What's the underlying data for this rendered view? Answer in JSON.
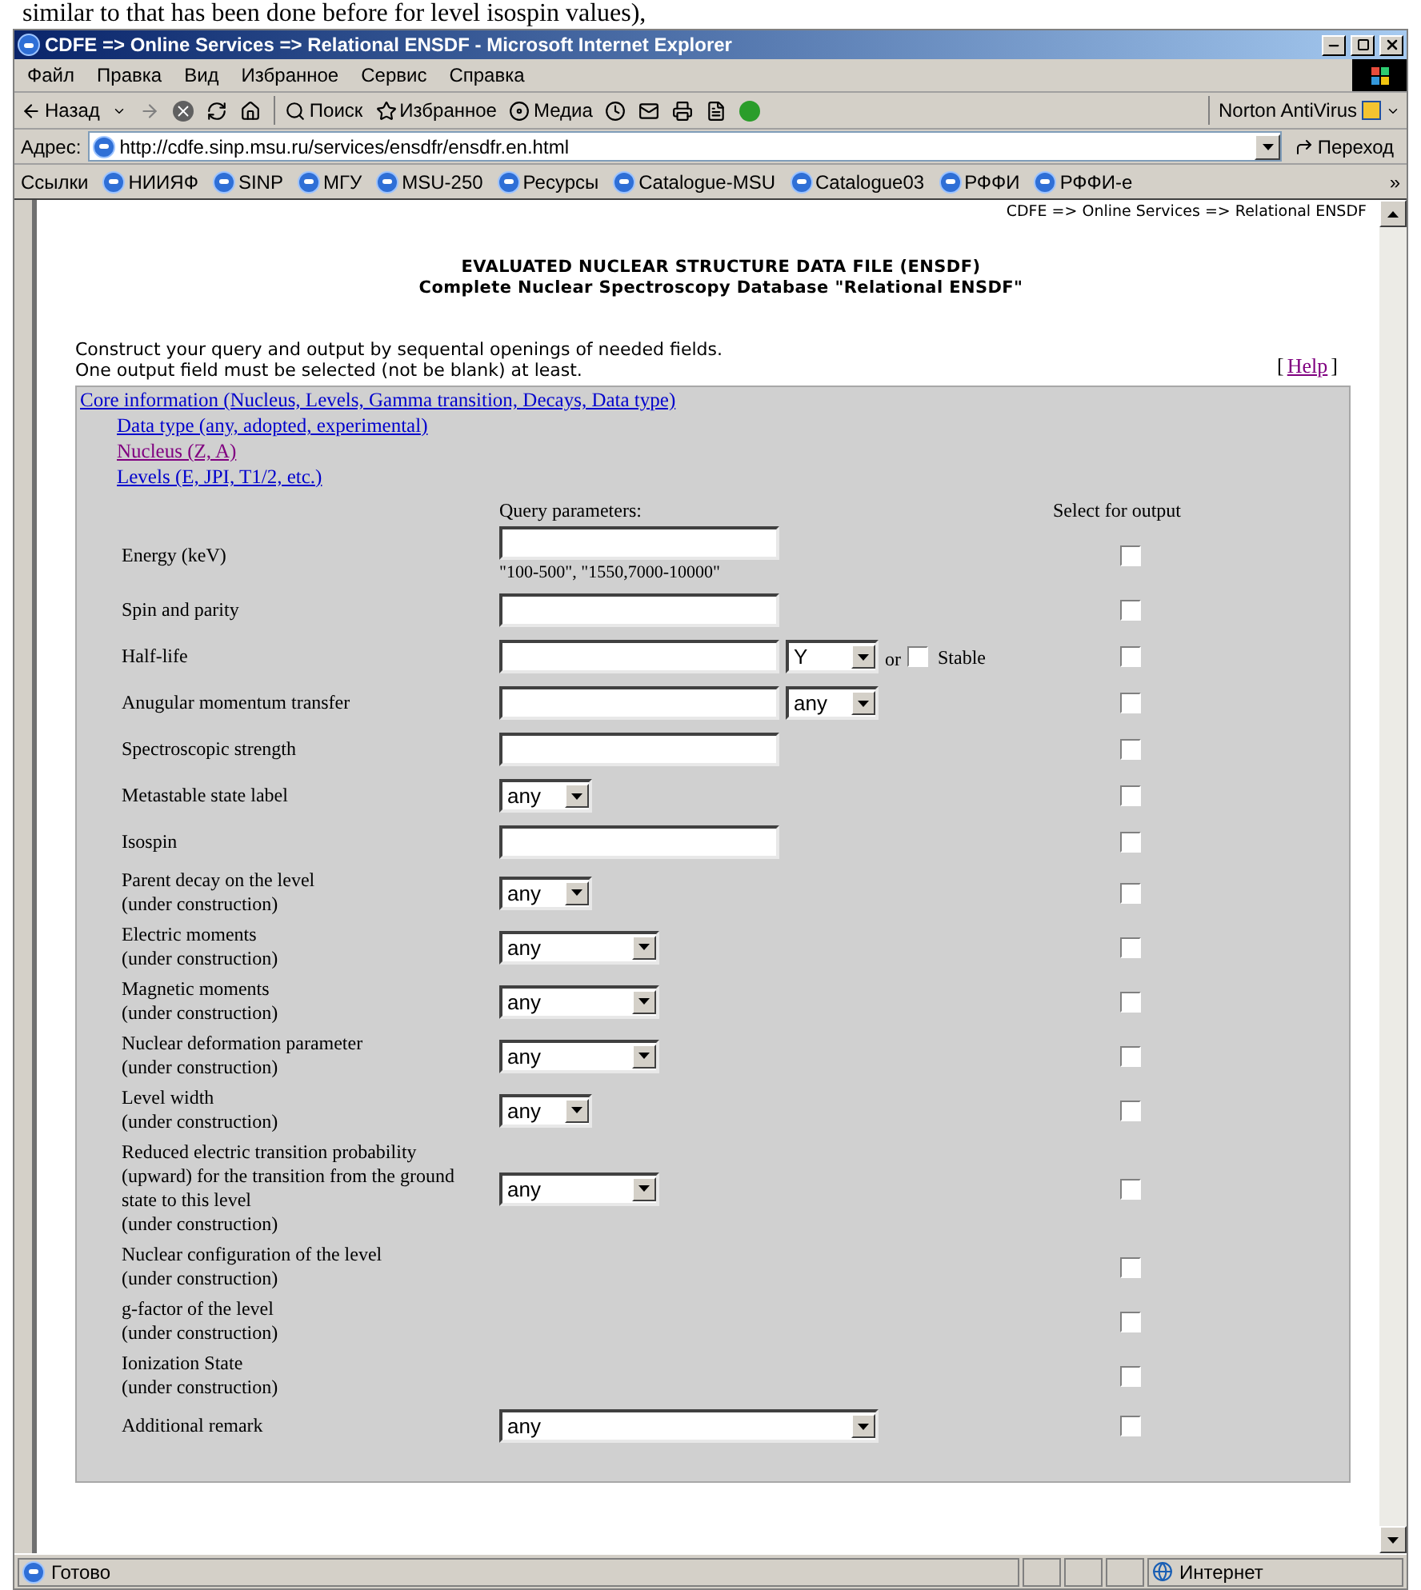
{
  "document_text": "similar to that has been done before for level isospin values),",
  "window": {
    "title": "CDFE => Online Services => Relational ENSDF - Microsoft Internet Explorer"
  },
  "menu": [
    "Файл",
    "Правка",
    "Вид",
    "Избранное",
    "Сервис",
    "Справка"
  ],
  "toolbar": {
    "back": "Назад",
    "search": "Поиск",
    "favorites": "Избранное",
    "media": "Медиа",
    "norton": "Norton AntiVirus"
  },
  "address": {
    "label": "Адрес:",
    "url": "http://cdfe.sinp.msu.ru/services/ensdfr/ensdfr.en.html",
    "go": "Переход"
  },
  "links": {
    "label": "Ссылки",
    "items": [
      "НИИЯФ",
      "SINP",
      "МГУ",
      "MSU-250",
      "Ресурсы",
      "Catalogue-MSU",
      "Catalogue03",
      "РФФИ",
      "РФФИ-е"
    ],
    "more": "»"
  },
  "page": {
    "breadcrumb": "CDFE => Online Services => Relational ENSDF",
    "title_lines": [
      "EVALUATED NUCLEAR STRUCTURE DATA FILE (ENSDF)",
      "Complete Nuclear Spectroscopy Database \"Relational ENSDF\""
    ],
    "intro": [
      "Construct your query and output by sequental openings of needed fields.",
      "One output field must be selected (not be blank) at least."
    ],
    "help": {
      "open": "[",
      "label": "Help",
      "close": "]"
    },
    "sections": [
      {
        "label": "Core information (Nucleus, Levels, Gamma transition, Decays, Data type)",
        "visited": false,
        "children": [
          {
            "label": "Data type (any, adopted, experimental)",
            "visited": false
          },
          {
            "label": "Nucleus (Z, A)",
            "visited": true
          },
          {
            "label": "Levels (E, JPI, T1/2, etc.)",
            "visited": false
          }
        ]
      }
    ],
    "query_header": "Query parameters:",
    "output_header": "Select for output",
    "rows": [
      {
        "label": "Energy (keV)",
        "fields": [
          {
            "kind": "text"
          }
        ],
        "hint": "\"100-500\", \"1550,7000-10000\"",
        "output": false
      },
      {
        "label": "Spin and parity",
        "fields": [
          {
            "kind": "text"
          }
        ],
        "output": false
      },
      {
        "label": "Half-life",
        "fields": [
          {
            "kind": "text"
          },
          {
            "kind": "select_small",
            "value": "Y"
          },
          {
            "kind": "word",
            "text": "or"
          },
          {
            "kind": "checkbox",
            "label": "Stable",
            "checked": false
          }
        ],
        "output": false
      },
      {
        "label": "Anugular momentum transfer",
        "fields": [
          {
            "kind": "text"
          },
          {
            "kind": "select_small",
            "value": "any"
          }
        ],
        "output": false
      },
      {
        "label": "Spectroscopic strength",
        "fields": [
          {
            "kind": "text"
          }
        ],
        "output": false
      },
      {
        "label": "Metastable state label",
        "fields": [
          {
            "kind": "select_small",
            "value": "any"
          }
        ],
        "output": false
      },
      {
        "label": "Isospin",
        "fields": [
          {
            "kind": "text"
          }
        ],
        "output": false
      },
      {
        "label": "Parent decay on the level",
        "note": "(under construction)",
        "fields": [
          {
            "kind": "select_small",
            "value": "any"
          }
        ],
        "output": false
      },
      {
        "label": "Electric moments",
        "note": "(under construction)",
        "fields": [
          {
            "kind": "select_medium",
            "value": "any"
          }
        ],
        "output": false
      },
      {
        "label": "Magnetic moments",
        "note": "(under construction)",
        "fields": [
          {
            "kind": "select_medium",
            "value": "any"
          }
        ],
        "output": false
      },
      {
        "label": "Nuclear deformation parameter",
        "note": "(under construction)",
        "fields": [
          {
            "kind": "select_medium",
            "value": "any"
          }
        ],
        "output": false
      },
      {
        "label": "Level width",
        "note": "(under construction)",
        "fields": [
          {
            "kind": "select_small",
            "value": "any"
          }
        ],
        "output": false
      },
      {
        "label": "Reduced electric transition probability (upward) for the transition from the ground state to this level",
        "note": "(under construction)",
        "fields": [
          {
            "kind": "select_medium",
            "value": "any"
          }
        ],
        "output": false
      },
      {
        "label": "Nuclear configuration of the level",
        "note": "(under construction)",
        "fields": [],
        "output": false
      },
      {
        "label": "g-factor of the level",
        "note": "(under construction)",
        "fields": [],
        "output": false
      },
      {
        "label": "Ionization State",
        "note": "(under construction)",
        "fields": [],
        "output": false
      },
      {
        "label": "Additional remark",
        "fields": [
          {
            "kind": "select_wide",
            "value": "any"
          }
        ],
        "output": false
      }
    ]
  },
  "status_bar": {
    "text": "Готово",
    "zone": "Интернет"
  }
}
